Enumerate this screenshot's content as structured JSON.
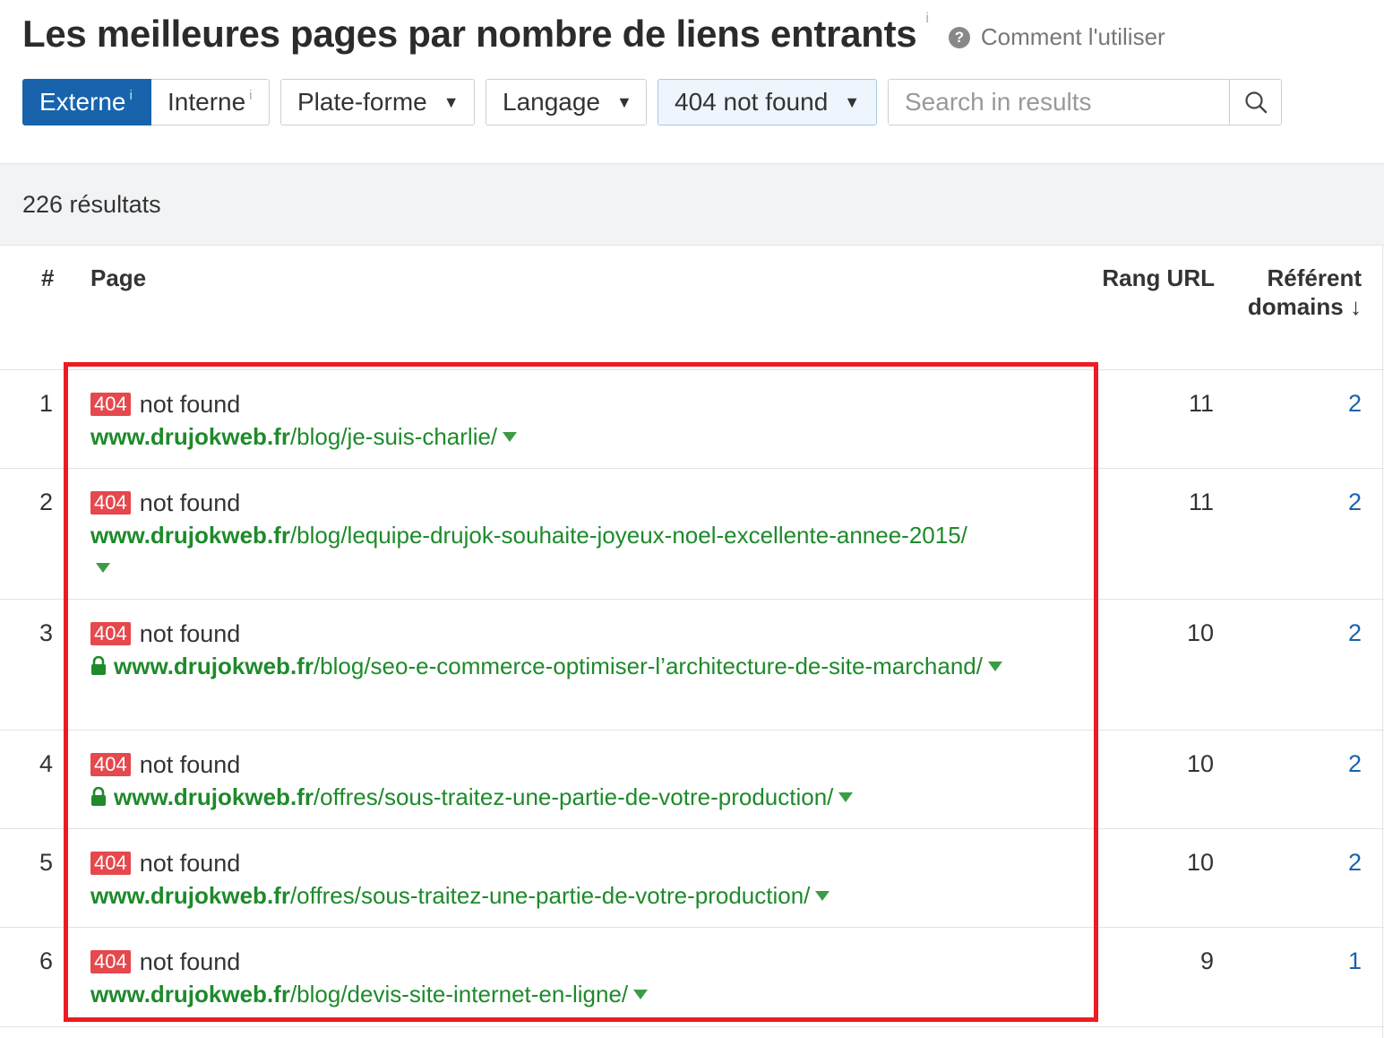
{
  "header": {
    "title": "Les meilleures pages par nombre de liens entrants",
    "title_info": "i",
    "help_icon": "?",
    "help_label": "Comment l'utiliser"
  },
  "toolbar": {
    "tabs": [
      {
        "label": "Externe",
        "info": "i",
        "active": true
      },
      {
        "label": "Interne",
        "info": "i",
        "active": false
      }
    ],
    "dropdowns": [
      {
        "label": "Plate-forme"
      },
      {
        "label": "Langage"
      },
      {
        "label": "404 not found",
        "selected": true
      }
    ],
    "search_placeholder": "Search in results",
    "search_icon": "magnifier-icon"
  },
  "results": {
    "count_label": "226 résultats"
  },
  "table": {
    "headers": {
      "num": "#",
      "page": "Page",
      "rank": "Rang URL",
      "ref_line1": "Référent",
      "ref_line2": "domains",
      "sort_icon": "↓"
    },
    "rows": [
      {
        "num": "1",
        "badge": "404",
        "status": "not found",
        "domain": "www.drujokweb.fr",
        "path": "/blog/je-suis-charlie/",
        "secure": false,
        "rank": "11",
        "ref": "2"
      },
      {
        "num": "2",
        "badge": "404",
        "status": "not found",
        "domain": "www.drujokweb.fr",
        "path": "/blog/lequipe-drujok-souhaite-joyeux-noel-excellente-annee-2015/",
        "secure": false,
        "rank": "11",
        "ref": "2"
      },
      {
        "num": "3",
        "badge": "404",
        "status": "not found",
        "domain": "www.drujokweb.fr",
        "path": "/blog/seo-e-commerce-optimiser-l’architecture-de-site-marchand/",
        "secure": true,
        "rank": "10",
        "ref": "2"
      },
      {
        "num": "4",
        "badge": "404",
        "status": "not found",
        "domain": "www.drujokweb.fr",
        "path": "/offres/sous-traitez-une-partie-de-votre-production/",
        "secure": true,
        "rank": "10",
        "ref": "2"
      },
      {
        "num": "5",
        "badge": "404",
        "status": "not found",
        "domain": "www.drujokweb.fr",
        "path": "/offres/sous-traitez-une-partie-de-votre-production/",
        "secure": false,
        "rank": "10",
        "ref": "2"
      },
      {
        "num": "6",
        "badge": "404",
        "status": "not found",
        "domain": "www.drujokweb.fr",
        "path": "/blog/devis-site-internet-en-ligne/",
        "secure": false,
        "rank": "9",
        "ref": "1"
      }
    ]
  },
  "colors": {
    "accent": "#1863ac",
    "url_green": "#1e8a2b",
    "badge_red": "#e5484d",
    "highlight_red": "#ed1c24"
  }
}
